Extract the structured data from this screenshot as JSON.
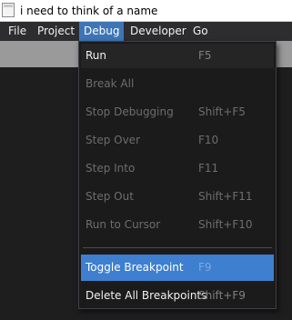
{
  "window": {
    "title": "i need to think of a name"
  },
  "menubar": {
    "items": [
      {
        "label": "File"
      },
      {
        "label": "Project"
      },
      {
        "label": "Debug"
      },
      {
        "label": "Developer"
      },
      {
        "label": "Go"
      }
    ],
    "active": "Debug"
  },
  "debug_menu": {
    "items": [
      {
        "label": "Run",
        "shortcut": "F5",
        "enabled": true
      },
      {
        "label": "Break All",
        "shortcut": "",
        "enabled": false
      },
      {
        "label": "Stop Debugging",
        "shortcut": "Shift+F5",
        "enabled": false
      },
      {
        "label": "Step Over",
        "shortcut": "F10",
        "enabled": false
      },
      {
        "label": "Step Into",
        "shortcut": "F11",
        "enabled": false
      },
      {
        "label": "Step Out",
        "shortcut": "Shift+F11",
        "enabled": false
      },
      {
        "label": "Run to Cursor",
        "shortcut": "Shift+F10",
        "enabled": false
      },
      {
        "label": "Toggle Breakpoint",
        "shortcut": "F9",
        "enabled": true,
        "selected": true
      },
      {
        "label": "Delete All Breakpoints",
        "shortcut": "Shift+F9",
        "enabled": true
      }
    ]
  },
  "colors": {
    "accent": "#3e7fcf",
    "menubar_bg": "#2d2d30",
    "menu_bg": "#1b1b1c",
    "editor_bg": "#1e1e1e",
    "disabled_text": "#6d6d6d"
  }
}
